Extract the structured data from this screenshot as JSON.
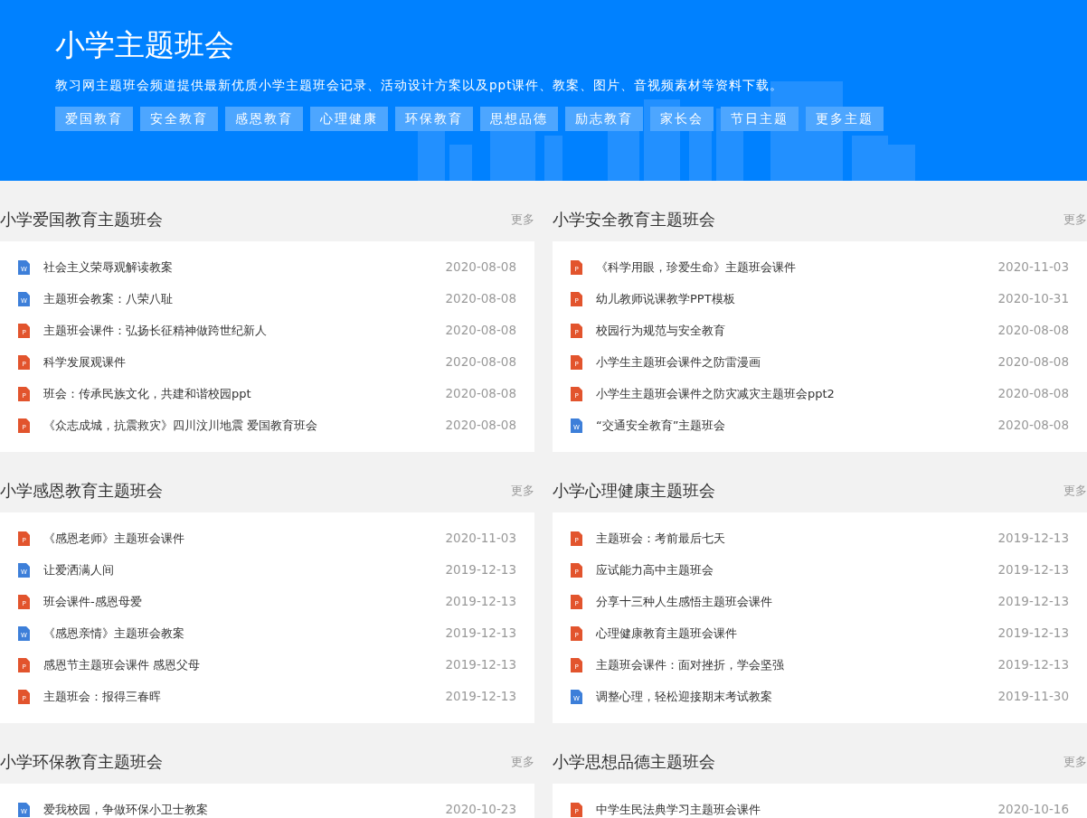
{
  "header": {
    "title": "小学主题班会",
    "description": "教习网主题班会频道提供最新优质小学主题班会记录、活动设计方案以及ppt课件、教案、图片、音视频素材等资料下载。",
    "tags": [
      "爱国教育",
      "安全教育",
      "感恩教育",
      "心理健康",
      "环保教育",
      "思想品德",
      "励志教育",
      "家长会",
      "节日主题",
      "更多主题"
    ]
  },
  "sections": [
    {
      "title": "小学爱国教育主题班会",
      "more": "更多",
      "items": [
        {
          "kind": "word",
          "icon_label": "W",
          "title": "社会主义荣辱观解读教案",
          "date": "2020-08-08"
        },
        {
          "kind": "word",
          "icon_label": "W",
          "title": "主题班会教案：八荣八耻",
          "date": "2020-08-08"
        },
        {
          "kind": "ppt",
          "icon_label": "P",
          "title": "主题班会课件：弘扬长征精神做跨世纪新人",
          "date": "2020-08-08"
        },
        {
          "kind": "ppt",
          "icon_label": "P",
          "title": "科学发展观课件",
          "date": "2020-08-08"
        },
        {
          "kind": "ppt",
          "icon_label": "P",
          "title": "班会：传承民族文化，共建和谐校园ppt",
          "date": "2020-08-08"
        },
        {
          "kind": "ppt",
          "icon_label": "P",
          "title": "《众志成城，抗震救灾》四川汶川地震 爱国教育班会",
          "date": "2020-08-08"
        }
      ]
    },
    {
      "title": "小学安全教育主题班会",
      "more": "更多",
      "items": [
        {
          "kind": "ppt",
          "icon_label": "P",
          "title": "《科学用眼，珍爱生命》主题班会课件",
          "date": "2020-11-03"
        },
        {
          "kind": "ppt",
          "icon_label": "P",
          "title": "幼儿教师说课教学PPT模板",
          "date": "2020-10-31"
        },
        {
          "kind": "ppt",
          "icon_label": "P",
          "title": "校园行为规范与安全教育",
          "date": "2020-08-08"
        },
        {
          "kind": "ppt",
          "icon_label": "P",
          "title": "小学生主题班会课件之防雷漫画",
          "date": "2020-08-08"
        },
        {
          "kind": "ppt",
          "icon_label": "P",
          "title": "小学生主题班会课件之防灾减灾主题班会ppt2",
          "date": "2020-08-08"
        },
        {
          "kind": "word",
          "icon_label": "W",
          "title": "“交通安全教育”主题班会",
          "date": "2020-08-08"
        }
      ]
    },
    {
      "title": "小学感恩教育主题班会",
      "more": "更多",
      "items": [
        {
          "kind": "ppt",
          "icon_label": "P",
          "title": "《感恩老师》主题班会课件",
          "date": "2020-11-03"
        },
        {
          "kind": "word",
          "icon_label": "W",
          "title": "让爱洒满人间",
          "date": "2019-12-13"
        },
        {
          "kind": "ppt",
          "icon_label": "P",
          "title": "班会课件-感恩母爱",
          "date": "2019-12-13"
        },
        {
          "kind": "word",
          "icon_label": "W",
          "title": "《感恩亲情》主题班会教案",
          "date": "2019-12-13"
        },
        {
          "kind": "ppt",
          "icon_label": "P",
          "title": "感恩节主题班会课件 感恩父母",
          "date": "2019-12-13"
        },
        {
          "kind": "ppt",
          "icon_label": "P",
          "title": "主题班会：报得三春晖",
          "date": "2019-12-13"
        }
      ]
    },
    {
      "title": "小学心理健康主题班会",
      "more": "更多",
      "items": [
        {
          "kind": "ppt",
          "icon_label": "P",
          "title": "主题班会：考前最后七天",
          "date": "2019-12-13"
        },
        {
          "kind": "ppt",
          "icon_label": "P",
          "title": "应试能力高中主题班会",
          "date": "2019-12-13"
        },
        {
          "kind": "ppt",
          "icon_label": "P",
          "title": "分享十三种人生感悟主题班会课件",
          "date": "2019-12-13"
        },
        {
          "kind": "ppt",
          "icon_label": "P",
          "title": "心理健康教育主题班会课件",
          "date": "2019-12-13"
        },
        {
          "kind": "ppt",
          "icon_label": "P",
          "title": "主题班会课件：面对挫折，学会坚强",
          "date": "2019-12-13"
        },
        {
          "kind": "word",
          "icon_label": "W",
          "title": "调整心理，轻松迎接期末考试教案",
          "date": "2019-11-30"
        }
      ]
    },
    {
      "title": "小学环保教育主题班会",
      "more": "更多",
      "items": [
        {
          "kind": "word",
          "icon_label": "W",
          "title": "爱我校园，争做环保小卫士教案",
          "date": "2020-10-23"
        }
      ]
    },
    {
      "title": "小学思想品德主题班会",
      "more": "更多",
      "items": [
        {
          "kind": "ppt",
          "icon_label": "P",
          "title": "中学生民法典学习主题班会课件",
          "date": "2020-10-16"
        }
      ]
    }
  ]
}
